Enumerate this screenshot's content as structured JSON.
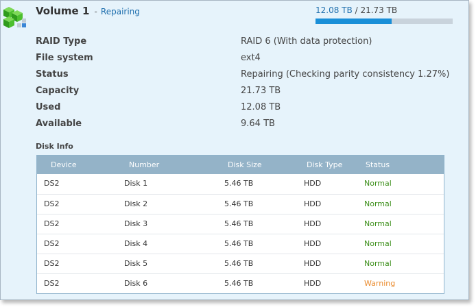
{
  "volume": {
    "title": "Volume 1",
    "separator": "-",
    "state": "Repairing",
    "icon": "volume-cubes-icon",
    "usage": {
      "used": "12.08 TB",
      "slash": "/",
      "total": "21.73 TB",
      "fraction_used": 0.556
    }
  },
  "details": [
    {
      "label": "RAID Type",
      "value": "RAID 6 (With data protection)"
    },
    {
      "label": "File system",
      "value": "ext4"
    },
    {
      "label": "Status",
      "value": "Repairing (Checking parity consistency 1.27%)"
    },
    {
      "label": "Capacity",
      "value": "21.73 TB"
    },
    {
      "label": "Used",
      "value": "12.08 TB"
    },
    {
      "label": "Available",
      "value": "9.64 TB"
    }
  ],
  "disk_info": {
    "heading": "Disk Info",
    "columns": [
      "Device",
      "Number",
      "Disk Size",
      "Disk Type",
      "Status"
    ],
    "rows": [
      {
        "device": "DS2",
        "number": "Disk 1",
        "size": "5.46 TB",
        "type": "HDD",
        "status": "Normal"
      },
      {
        "device": "DS2",
        "number": "Disk 2",
        "size": "5.46 TB",
        "type": "HDD",
        "status": "Normal"
      },
      {
        "device": "DS2",
        "number": "Disk 3",
        "size": "5.46 TB",
        "type": "HDD",
        "status": "Normal"
      },
      {
        "device": "DS2",
        "number": "Disk 4",
        "size": "5.46 TB",
        "type": "HDD",
        "status": "Normal"
      },
      {
        "device": "DS2",
        "number": "Disk 5",
        "size": "5.46 TB",
        "type": "HDD",
        "status": "Normal"
      },
      {
        "device": "DS2",
        "number": "Disk 6",
        "size": "5.46 TB",
        "type": "HDD",
        "status": "Warning"
      }
    ]
  },
  "colors": {
    "panel_bg": "#e6f3fb",
    "accent": "#1f6fae",
    "bar_fill": "#1a8fd8",
    "header_bg": "#94b3c8",
    "normal": "#3c8f1a",
    "warning": "#ea8a2c"
  }
}
